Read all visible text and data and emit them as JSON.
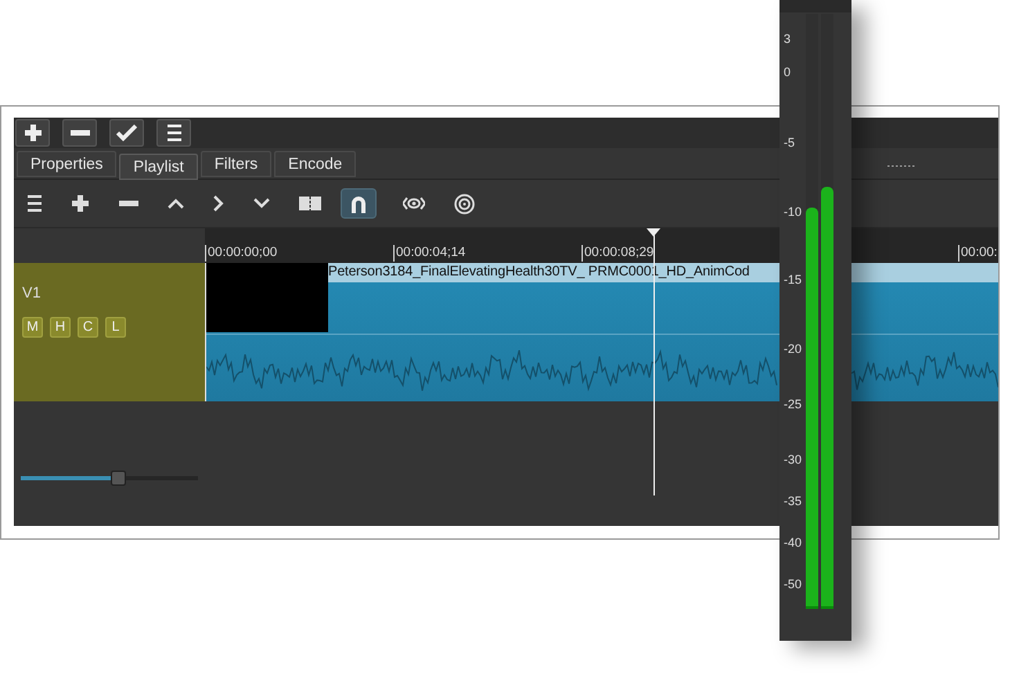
{
  "tabs": [
    {
      "label": "Properties",
      "selected": false
    },
    {
      "label": "Playlist",
      "selected": true
    },
    {
      "label": "Filters",
      "selected": false
    },
    {
      "label": "Encode",
      "selected": false
    }
  ],
  "timeline_toolbar": {
    "snap_on": true
  },
  "ruler": {
    "labels": [
      "00:00:00;00",
      "00:00:04;14",
      "00:00:08;29",
      "00:00:"
    ]
  },
  "track": {
    "name": "V1",
    "buttons": [
      "M",
      "H",
      "C",
      "L"
    ],
    "clip_title": "Peterson3184_FinalElevatingHealth30TV_ PRMC0001_HD_AnimCod"
  },
  "zoom_slider": {
    "level": 0.55
  },
  "audio_meter": {
    "scale": [
      "3",
      "0",
      "-5",
      "-10",
      "-15",
      "-20",
      "-25",
      "-30",
      "-35",
      "-40",
      "-50"
    ],
    "channels": [
      {
        "level": 0.67
      },
      {
        "level": 0.705
      }
    ]
  }
}
